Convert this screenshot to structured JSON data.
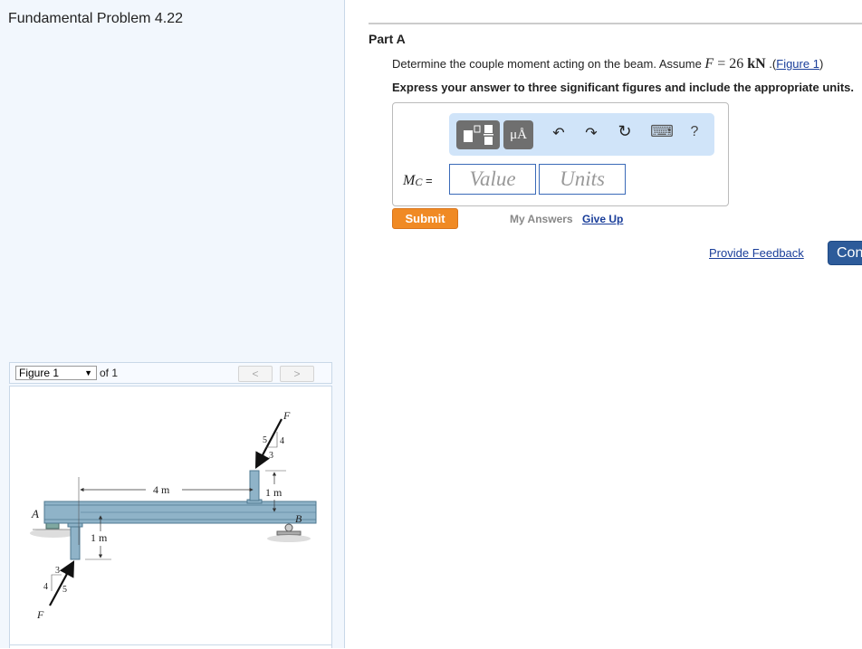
{
  "problem": {
    "title": "Fundamental Problem 4.22"
  },
  "figure_nav": {
    "selected": "Figure 1",
    "of_label": "of 1",
    "prev_glyph": "<",
    "next_glyph": ">"
  },
  "figure": {
    "labels": {
      "point_a": "A",
      "point_b": "B",
      "force_top": "F",
      "force_bottom": "F",
      "dim_horizontal": "4 m",
      "dim_top_post": "1 m",
      "dim_bottom_post": "1 m",
      "top_tri_hyp": "5",
      "top_tri_vert": "4",
      "top_tri_horiz": "3",
      "bot_tri_horiz": "3",
      "bot_tri_vert": "4",
      "bot_tri_hyp": "5"
    },
    "colors": {
      "beam": "#8fb3c8",
      "beam_dark": "#4f7890",
      "support": "#7fa8a0"
    }
  },
  "part": {
    "label": "Part A",
    "question_prefix": "Determine the couple moment acting on the beam. Assume ",
    "math_var": "F",
    "math_eq": " = 26 ",
    "math_unit": "kN",
    "question_suffix": " .(",
    "figure_link": "Figure 1",
    "close_paren": ")",
    "instruction": "Express your answer to three significant figures and include the appropriate units."
  },
  "answer": {
    "label_main": "M",
    "label_sub": "C",
    "label_eq": " =",
    "value_placeholder": "Value",
    "units_placeholder": "Units",
    "toolbar": {
      "templates_icon": "templates-icon",
      "units_label": "μÅ",
      "undo_glyph": "↶",
      "redo_glyph": "↷",
      "reset_glyph": "↻",
      "keyboard_glyph": "⌨",
      "help_glyph": "?"
    }
  },
  "actions": {
    "submit": "Submit",
    "my_answers": "My Answers",
    "give_up": "Give Up",
    "provide_feedback": "Provide Feedback",
    "continue": "Con"
  },
  "colors": {
    "accent_orange": "#f08a24",
    "link_blue": "#1a3e9a",
    "continue_blue": "#2d5b9a",
    "toolbar_bg": "#d0e4f9"
  }
}
